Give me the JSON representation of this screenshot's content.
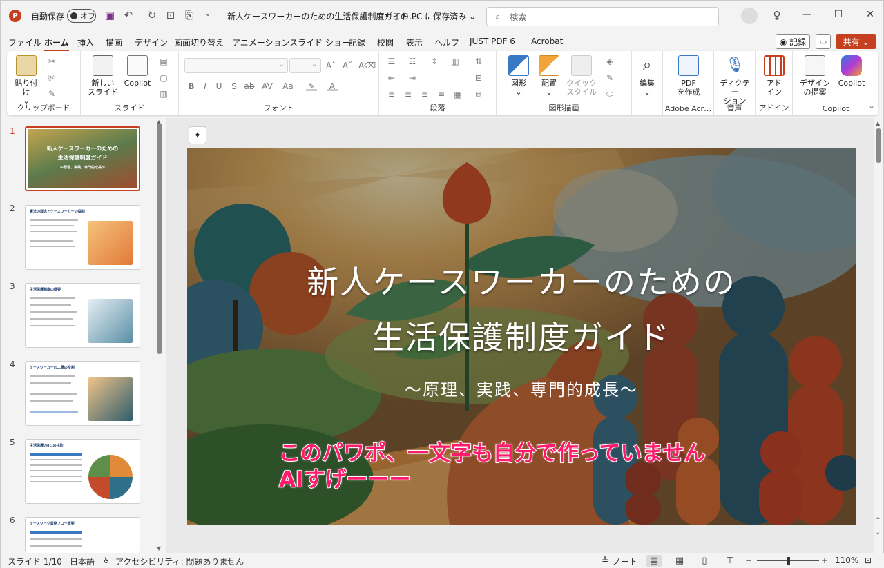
{
  "titlebar": {
    "autosave_label": "自動保存",
    "autosave_state": "オフ",
    "doc_title": "新人ケースワーカーのための生活保護制度ガイド…",
    "save_status": "• この PC に保存済み ⌄",
    "search_placeholder": "検索"
  },
  "tabs": [
    "ファイル",
    "ホーム",
    "挿入",
    "描画",
    "デザイン",
    "画面切り替え",
    "アニメーション",
    "スライド ショー",
    "記録",
    "校閲",
    "表示",
    "ヘルプ",
    "JUST PDF 6",
    "Acrobat"
  ],
  "active_tab": "ホーム",
  "buttons": {
    "record": "◉ 記録",
    "comment": "▭",
    "share": "共有 ⌄"
  },
  "ribbon": {
    "clipboard": {
      "paste": "貼り付け",
      "label": "クリップボード"
    },
    "slide": {
      "new_slide": "新しい",
      "new_slide2": "スライド",
      "copilot": "Copilot",
      "label": "スライド"
    },
    "font": {
      "label": "フォント"
    },
    "paragraph": {
      "label": "段落"
    },
    "drawing": {
      "shapes": "図形",
      "arrange": "配置",
      "quick": "クイック",
      "quick2": "スタイル",
      "label": "図形描画"
    },
    "edit": {
      "edit": "編集"
    },
    "adobe": {
      "pdf": "PDF",
      "pdf2": "を作成",
      "label": "Adobe Acr…"
    },
    "voice": {
      "dictate": "ディクテー",
      "dictate2": "ション",
      "label": "音声"
    },
    "addin": {
      "addin": "アド",
      "addin2": "イン",
      "label": "アドイン"
    },
    "copilot": {
      "design": "デザイン",
      "design2": "の提案",
      "copilot": "Copilot",
      "label": "Copilot"
    }
  },
  "thumbnails": [
    {
      "num": "1",
      "title": "新人ケースワーカーのための",
      "title2": "生活保護制度ガイド",
      "sub": "〜原理、実践、専門的成長〜"
    },
    {
      "num": "2",
      "title": "憲法の理念とケースワーカーの役割"
    },
    {
      "num": "3",
      "title": "生活保護制度の概要"
    },
    {
      "num": "4",
      "title": "ケースワーカーの二重の役割"
    },
    {
      "num": "5",
      "title": "生活保護の8つの扶助"
    },
    {
      "num": "6",
      "title": "ケースワーク業務フロー概要"
    }
  ],
  "slide": {
    "title_line1": "新人ケースワーカーのための",
    "title_line2": "生活保護制度ガイド",
    "subtitle": "〜原理、実践、専門的成長〜"
  },
  "overlay": {
    "line1": "このパワポ、一文字も自分で作っていません",
    "line2": "AIすげーーー"
  },
  "status": {
    "slide_count": "スライド 1/10",
    "language": "日本語",
    "accessibility": "アクセシビリティ: 問題ありません",
    "notes": "ノート",
    "zoom": "110%"
  },
  "colors": {
    "accent": "#c4401f",
    "overlay_text": "#ff1a6b"
  }
}
